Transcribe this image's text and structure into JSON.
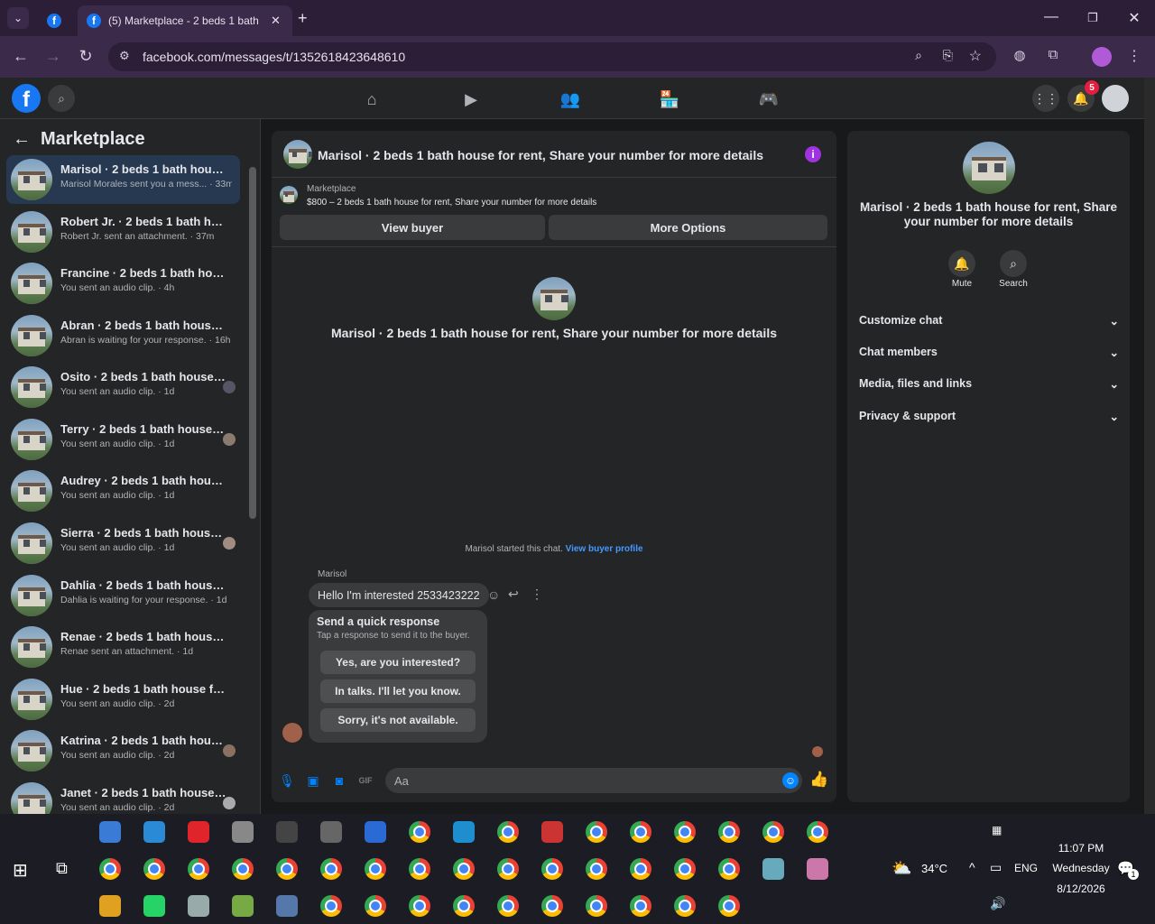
{
  "browser": {
    "tab_title": "(5) Marketplace - 2 beds 1 bath",
    "url": "facebook.com/messages/t/1352618423648610"
  },
  "header": {
    "notification_count": "5"
  },
  "sidebar": {
    "title": "Marketplace",
    "conversations": [
      {
        "name": "Marisol · 2 beds 1 bath house fo...",
        "sub": "Marisol Morales sent you a mess... · 33m"
      },
      {
        "name": "Robert Jr. · 2 beds 1 bath house ...",
        "sub": "Robert Jr. sent an attachment. · 37m"
      },
      {
        "name": "Francine · 2 beds 1 bath house f...",
        "sub": "You sent an audio clip. · 4h"
      },
      {
        "name": "Abran · 2 beds 1 bath house for ...",
        "sub": "Abran is waiting for your response. · 16h"
      },
      {
        "name": "Osito · 2 beds 1 bath house f...",
        "sub": "You sent an audio clip. · 1d"
      },
      {
        "name": "Terry · 2 beds 1 bath house fo...",
        "sub": "You sent an audio clip. · 1d"
      },
      {
        "name": "Audrey · 2 beds 1 bath house fo...",
        "sub": "You sent an audio clip. · 1d"
      },
      {
        "name": "Sierra · 2 beds 1 bath house f...",
        "sub": "You sent an audio clip. · 1d"
      },
      {
        "name": "Dahlia · 2 beds 1 bath house for...",
        "sub": "Dahlia is waiting for your response. · 1d"
      },
      {
        "name": "Renae · 2 beds 1 bath house for ...",
        "sub": "Renae sent an attachment. · 1d"
      },
      {
        "name": "Hue · 2 beds 1 bath house for re...",
        "sub": "You sent an audio clip. · 2d"
      },
      {
        "name": "Katrina · 2 beds 1 bath house ...",
        "sub": "You sent an audio clip. · 2d"
      },
      {
        "name": "Janet · 2 beds 1 bath house fo...",
        "sub": "You sent an audio clip. · 2d"
      }
    ]
  },
  "chat": {
    "title": "Marisol · 2 beds 1 bath house for rent, Share your number for more details",
    "marketplace_label": "Marketplace",
    "listing_line": "$800 – 2 beds 1 bath house for rent, Share your number for more details",
    "view_buyer": "View buyer",
    "more_options": "More Options",
    "center_title": "Marisol · 2 beds 1 bath house for rent, Share your number for more details",
    "started_text": "Marisol started this chat.",
    "started_link": "View buyer profile",
    "sender": "Marisol",
    "message": "Hello I'm interested 2533423222",
    "quick_title": "Send a quick response",
    "quick_sub": "Tap a response to send it to the buyer.",
    "quick_1": "Yes, are you interested?",
    "quick_2": "In talks. I'll let you know.",
    "quick_3": "Sorry, it's not available.",
    "composer_placeholder": "Aa"
  },
  "details": {
    "title": "Marisol · 2 beds 1 bath house for rent, Share your number for more details",
    "mute": "Mute",
    "search": "Search",
    "sections": [
      "Customize chat",
      "Chat members",
      "Media, files and links",
      "Privacy & support"
    ]
  },
  "taskbar": {
    "temperature": "34°C",
    "language": "ENG",
    "time": "11:07 PM",
    "day": "Wednesday",
    "date": "8/12/2026",
    "notif_count": "1"
  }
}
